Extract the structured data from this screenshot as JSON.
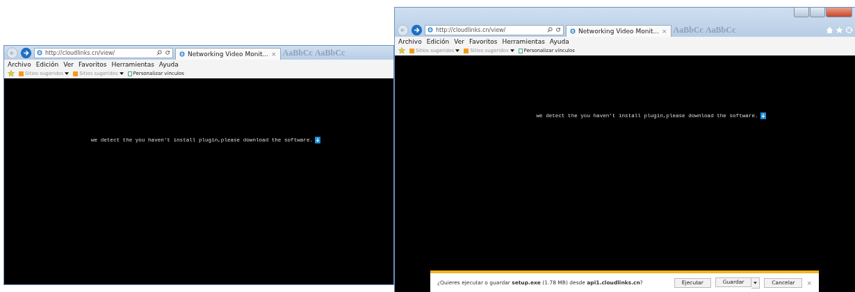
{
  "windows": [
    {
      "has_title_controls": false,
      "address": "http://cloudlinks.cn/view/",
      "tab": {
        "title": "Networking Video Monit...",
        "close": "×"
      },
      "behind_text": [
        "AaBbCc",
        "AaBbCc"
      ],
      "menu": [
        "Archivo",
        "Edición",
        "Ver",
        "Favoritos",
        "Herramientas",
        "Ayuda"
      ],
      "favorites": [
        {
          "label": "Sitios sugeridos",
          "kind": "dropdown"
        },
        {
          "label": "Sitios sugeridos",
          "kind": "dropdown"
        },
        {
          "label": "Personalizar vínculos",
          "kind": "link"
        }
      ],
      "message": "we detect the you haven't install plugin,please download the software."
    },
    {
      "has_title_controls": true,
      "address": "http://cloudlinks.cn/view/",
      "tab": {
        "title": "Networking Video Monit...",
        "close": "×"
      },
      "behind_text": [
        "AaBbCc",
        "AaBbCc"
      ],
      "menu": [
        "Archivo",
        "Edición",
        "Ver",
        "Favoritos",
        "Herramientas",
        "Ayuda"
      ],
      "favorites": [
        {
          "label": "Sitios sugeridos",
          "kind": "dropdown"
        },
        {
          "label": "Sitios sugeridos",
          "kind": "dropdown"
        },
        {
          "label": "Personalizar vínculos",
          "kind": "link"
        }
      ],
      "message": "we detect the you haven't install plugin,please download the software.",
      "download_bar": {
        "prompt": "¿Quieres ejecutar o guardar **setup.exe** (1.78 MB) desde **api1.cloudlinks.cn**?",
        "buttons": [
          "Ejecutar",
          "Guardar",
          "Cancelar"
        ],
        "close": "×"
      }
    }
  ]
}
